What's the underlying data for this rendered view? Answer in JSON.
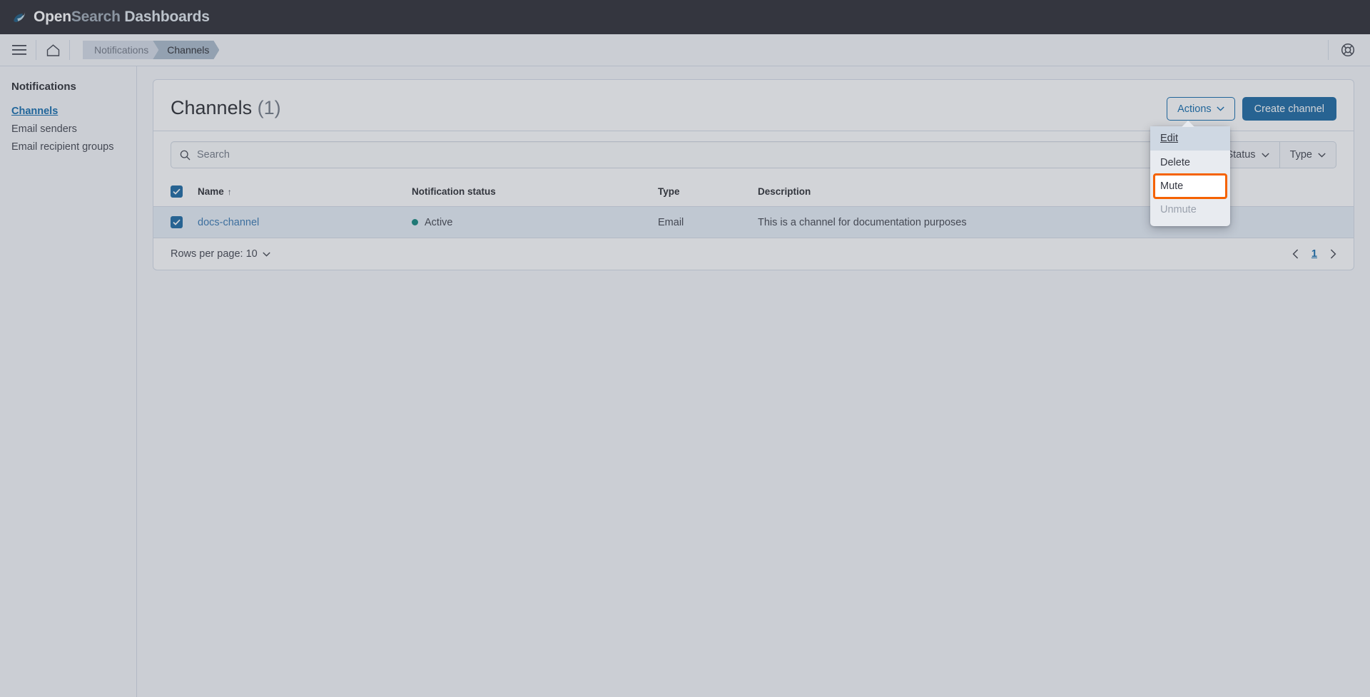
{
  "header": {
    "brand_open": "Open",
    "brand_search": "Search",
    "brand_dashboards": "Dashboards",
    "menu_icon": "hamburger-menu-icon",
    "home_icon": "home-icon",
    "help_icon": "help-lifebuoy-icon"
  },
  "breadcrumbs": [
    {
      "label": "Notifications",
      "active": false
    },
    {
      "label": "Channels",
      "active": true
    }
  ],
  "sidebar": {
    "title": "Notifications",
    "items": [
      {
        "label": "Channels",
        "selected": true
      },
      {
        "label": "Email senders",
        "selected": false
      },
      {
        "label": "Email recipient groups",
        "selected": false
      }
    ]
  },
  "panel": {
    "title": "Channels",
    "count": "(1)",
    "actions_label": "Actions",
    "create_label": "Create channel"
  },
  "search": {
    "placeholder": "Search",
    "value": "",
    "icon": "search-icon"
  },
  "filters": [
    {
      "label": "Status"
    },
    {
      "label": "Type"
    }
  ],
  "table": {
    "columns": [
      {
        "label": "Name",
        "sorted": "asc"
      },
      {
        "label": "Notification status"
      },
      {
        "label": "Type"
      },
      {
        "label": "Description"
      }
    ],
    "rows": [
      {
        "checked": true,
        "name": "docs-channel",
        "status": "Active",
        "type": "Email",
        "description": "This is a channel for documentation purposes"
      }
    ],
    "header_checked": true
  },
  "footer": {
    "rows_per_page_label": "Rows per page: 10",
    "current_page": "1",
    "prev_icon": "chevron-left-icon",
    "next_icon": "chevron-right-icon"
  },
  "popover": {
    "items": [
      {
        "label": "Edit",
        "state": "focused"
      },
      {
        "label": "Delete",
        "state": "normal"
      },
      {
        "label": "Mute",
        "state": "highlighted"
      },
      {
        "label": "Unmute",
        "state": "disabled"
      }
    ]
  },
  "colors": {
    "brand_dark": "#1d1e24",
    "primary": "#0b5e9b",
    "link": "#0061a6",
    "status_active": "#017d73",
    "highlight_outline": "#f56200",
    "page_bg": "#f5f7fa",
    "border": "#d3dae6"
  }
}
